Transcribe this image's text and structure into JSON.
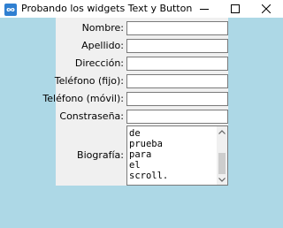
{
  "window": {
    "title": "Probando los widgets Text y Button",
    "icon": "infinity-icon",
    "icon_color": "#2f7fd1"
  },
  "form": {
    "fields": [
      {
        "label": "Nombre:",
        "value": ""
      },
      {
        "label": "Apellido:",
        "value": ""
      },
      {
        "label": "Dirección:",
        "value": ""
      },
      {
        "label": "Teléfono (fijo):",
        "value": ""
      },
      {
        "label": "Teléfono (móvil):",
        "value": ""
      },
      {
        "label": "Constraseña:",
        "value": ""
      }
    ],
    "biography": {
      "label": "Biografía:",
      "text": "de\nprueba\npara\nel\nscroll."
    }
  },
  "colors": {
    "desktop": "#add8e6",
    "client": "#f0f0f0"
  }
}
